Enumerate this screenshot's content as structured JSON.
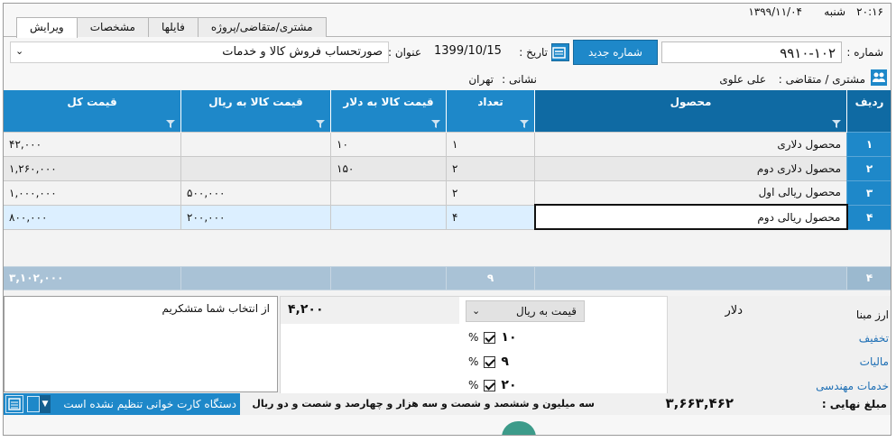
{
  "window": {
    "clock": "۲۰:۱۶",
    "day_name": "شنبه",
    "date": "۱۳۹۹/۱۱/۰۴"
  },
  "tabs": [
    {
      "label": "ویرایش",
      "active": true
    },
    {
      "label": "مشخصات",
      "active": false
    },
    {
      "label": "فایلها",
      "active": false
    },
    {
      "label": "مشتری/متقاضی/پروژه",
      "active": false
    }
  ],
  "header": {
    "number_label": "شماره :",
    "number_value": "۹۹۱۰-۱۰۲",
    "new_number_button": "شماره جدید",
    "date_label": "تاریخ :",
    "date_value": "1399/10/15",
    "title_label": "عنوان :",
    "title_value": "صورتحساب فروش کالا و خدمات",
    "customer_label": "مشتری / متقاضی :",
    "customer_value": "علی علوی",
    "address_label": "نشانی :",
    "address_value": "تهران"
  },
  "grid": {
    "columns": [
      "ردیف",
      "محصول",
      "تعداد",
      "قیمت کالا به دلار",
      "قیمت کالا به ریال",
      "قیمت کل"
    ],
    "rows": [
      {
        "idx": "۱",
        "product": "محصول دلاری",
        "qty": "۱",
        "usd": "۱۰",
        "rial": "",
        "total": "۴۲,۰۰۰"
      },
      {
        "idx": "۲",
        "product": "محصول دلاری دوم",
        "qty": "۲",
        "usd": "۱۵۰",
        "rial": "",
        "total": "۱,۲۶۰,۰۰۰"
      },
      {
        "idx": "۳",
        "product": "محصول ریالی اول",
        "qty": "۲",
        "usd": "",
        "rial": "۵۰۰,۰۰۰",
        "total": "۱,۰۰۰,۰۰۰"
      },
      {
        "idx": "۴",
        "product": "محصول ریالی دوم",
        "qty": "۴",
        "usd": "",
        "rial": "۲۰۰,۰۰۰",
        "total": "۸۰۰,۰۰۰"
      }
    ],
    "totals": {
      "count": "۴",
      "qty": "۹",
      "total": "۳,۱۰۲,۰۰۰"
    }
  },
  "lower": {
    "note": "از انتخاب شما متشکریم",
    "base_currency_label": "ارز مبنا",
    "base_currency_value": "دلار",
    "price_mode": "قیمت به ریال",
    "base_amount": "۴,۲۰۰",
    "discount_label": "تخفیف",
    "tax_label": "مالیات",
    "engineering_label": "خدمات مهندسی",
    "tax_value": "۹",
    "engineering_value": "۲۰",
    "third_value": "۱۰",
    "percent": "%"
  },
  "footer": {
    "final_label": "مبلغ نهایی :",
    "final_value": "۳,۶۶۳,۴۶۲",
    "final_words": "سه میلیون و ششصد و شصت و سه هزار و چهارصد و شصت و دو ریال",
    "card_reader_status": "دستگاه کارت خوانی تنظیم نشده است"
  },
  "colors": {
    "accent": "#1e88c9",
    "accent_dark": "#0f6aa3",
    "totals_row": "#a9c2d6",
    "link": "#1e6fb5"
  }
}
